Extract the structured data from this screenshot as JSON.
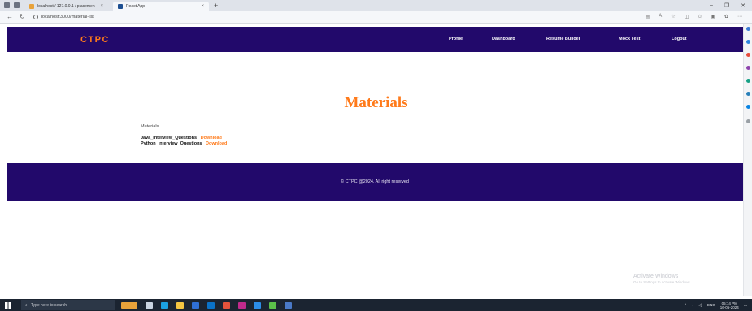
{
  "browser": {
    "tabs": [
      {
        "title": "localhost / 127.0.0.1 / placemen",
        "active": false
      },
      {
        "title": "React App",
        "active": true
      }
    ],
    "url": "localhost:3000/material-list"
  },
  "navbar": {
    "brand": "CTPC",
    "links": [
      "Profile",
      "Dashboard",
      "Resume Builder",
      "Mock Test",
      "Logout"
    ]
  },
  "main": {
    "heading": "Materials",
    "section_label": "Materials",
    "items": [
      {
        "name": "Java_Interview_Questions",
        "action": "Download"
      },
      {
        "name": "Python_Interview_Questions",
        "action": "Download"
      }
    ]
  },
  "footer": {
    "text": "© CTPC @2024. All right reserved"
  },
  "watermark": {
    "title": "Activate Windows",
    "subtitle": "Go to Settings to activate Windows."
  },
  "taskbar": {
    "search_placeholder": "Type here to search",
    "weather": "",
    "language": "ENG",
    "time": "05:14 PM",
    "date": "16-05-2024"
  },
  "colors": {
    "nav_bg": "#22096b",
    "accent": "#ff7a1a"
  }
}
